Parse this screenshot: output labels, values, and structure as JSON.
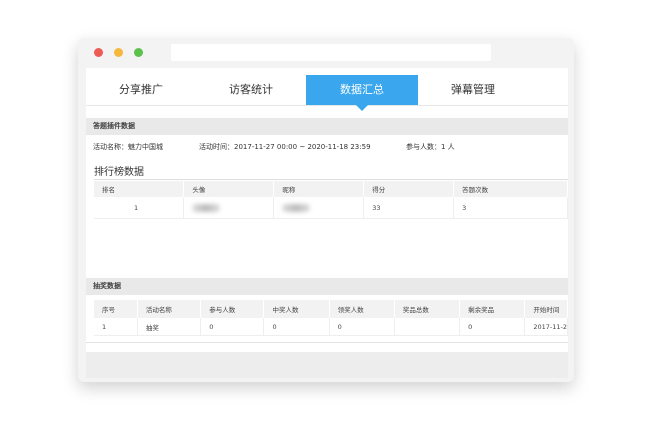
{
  "tabs": [
    {
      "label": "分享推广",
      "active": false
    },
    {
      "label": "访客统计",
      "active": false
    },
    {
      "label": "数据汇总",
      "active": true
    },
    {
      "label": "弹幕管理",
      "active": false
    }
  ],
  "colors": {
    "accent": "#3aa6ee",
    "section_bg": "#e9e9e9"
  },
  "quiz_section": {
    "title": "答题插件数据",
    "activity_name_label": "活动名称：",
    "activity_name": "魅力中国城",
    "activity_time_label": "活动时间：",
    "activity_time_start": "2017-11-27 00:00",
    "activity_time_sep": "~",
    "activity_time_end": "2020-11-18 23:59",
    "participants_label": "参与人数：",
    "participants": "1 人"
  },
  "ranking": {
    "title": "排行榜数据",
    "columns": [
      "排名",
      "头像",
      "昵称",
      "得分",
      "答题次数"
    ],
    "rows": [
      {
        "rank": "1",
        "score": "33",
        "attempts": "3"
      }
    ]
  },
  "lottery_section": {
    "title": "抽奖数据",
    "columns": [
      "序号",
      "活动名称",
      "参与人数",
      "中奖人数",
      "领奖人数",
      "奖品总数",
      "剩余奖品",
      "开始时间"
    ],
    "rows": [
      {
        "index": "1",
        "name": "抽奖",
        "participants": "0",
        "winners": "0",
        "claimed": "0",
        "total_prizes": "",
        "remaining": "0",
        "start": "2017-11-2"
      }
    ]
  }
}
